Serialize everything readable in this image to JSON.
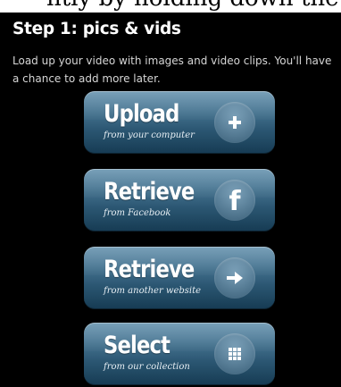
{
  "header_fragment": "ntly by holding down the CTRL",
  "step": {
    "title": "Step 1: pics & vids",
    "description": "Load up your video with images and video clips. You'll have a chance to add more later."
  },
  "buttons": [
    {
      "label": "Upload",
      "sub": "from your computer",
      "icon": "plus-icon"
    },
    {
      "label": "Retrieve",
      "sub": "from Facebook",
      "icon": "facebook-icon",
      "glyph": "f"
    },
    {
      "label": "Retrieve",
      "sub": "from another website",
      "icon": "arrow-right-icon"
    },
    {
      "label": "Select",
      "sub": "from our collection",
      "icon": "grid-icon"
    }
  ],
  "colors": {
    "background": "#000000",
    "button_top": "#5f8eab",
    "button_bottom": "#163b53",
    "text": "#ffffff"
  }
}
